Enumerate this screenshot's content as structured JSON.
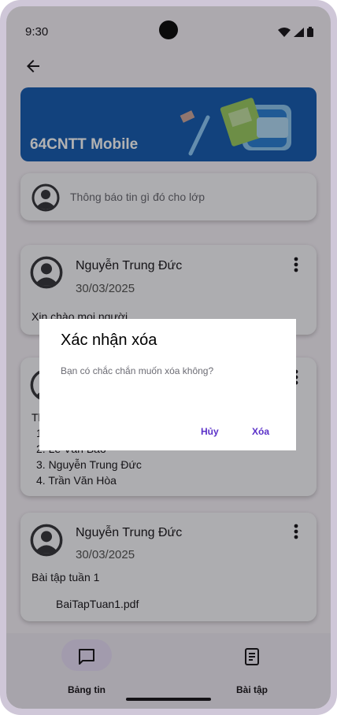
{
  "status_bar": {
    "time": "9:30"
  },
  "banner": {
    "title": "64CNTT Mobile"
  },
  "composer": {
    "placeholder": "Thông báo tin gì đó cho lớp"
  },
  "posts": [
    {
      "author": "Nguyễn Trung Đức",
      "date": "30/03/2025",
      "content": "Xin chào mọi người"
    },
    {
      "content_prefix": "Th",
      "list": [
        "1",
        "2. Lê Văn Bảo",
        "3. Nguyễn Trung Đức",
        "4. Trần Văn Hòa"
      ]
    },
    {
      "author": "Nguyễn Trung Đức",
      "date": "30/03/2025",
      "content": "Bài tập tuần 1",
      "attachment": "BaiTapTuan1.pdf"
    }
  ],
  "bottom_nav": {
    "items": [
      {
        "label": "Bảng tin",
        "icon": "chat-bubble-icon",
        "active": true
      },
      {
        "label": "Bài tập",
        "icon": "document-icon",
        "active": false
      }
    ]
  },
  "dialog": {
    "title": "Xác nhận xóa",
    "message": "Bạn có chắc chắn muốn xóa không?",
    "cancel_label": "Hủy",
    "confirm_label": "Xóa"
  },
  "colors": {
    "accent": "#5a30c8",
    "banner": "#1a5fb4",
    "nav_active": "#e8def8"
  }
}
